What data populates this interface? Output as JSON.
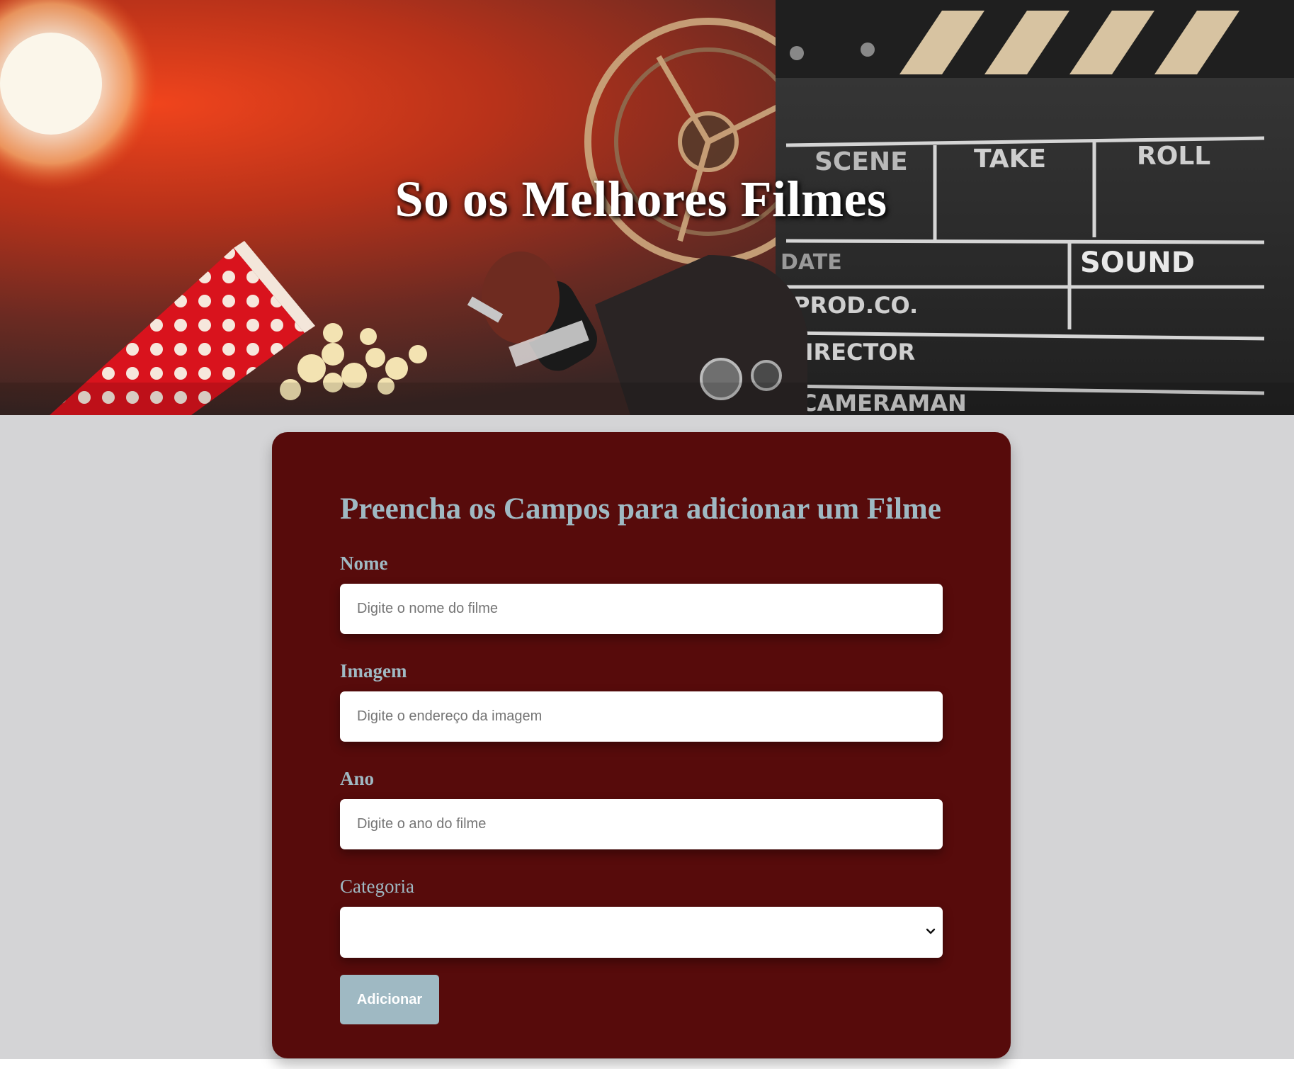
{
  "header": {
    "title": "So os Melhores Filmes"
  },
  "form": {
    "title": "Preencha os Campos para adicionar um Filme",
    "fields": {
      "nome": {
        "label": "Nome",
        "placeholder": "Digite o nome do filme",
        "value": ""
      },
      "imagem": {
        "label": "Imagem",
        "placeholder": "Digite o endereço da imagem",
        "value": ""
      },
      "ano": {
        "label": "Ano",
        "placeholder": "Digite o ano do filme",
        "value": ""
      },
      "categoria": {
        "label": "Categoria",
        "selected": ""
      }
    },
    "submit_label": "Adicionar"
  },
  "banner_art": {
    "clapper_labels": [
      "SCENE",
      "TAKE",
      "ROLL",
      "DATE",
      "SOUND",
      "PROD.CO.",
      "DIRECTOR",
      "CAMERAMAN"
    ]
  },
  "colors": {
    "page_background": "#d4d4d6",
    "card_background": "#570b0b",
    "accent": "#9fb9c3",
    "input_background": "#ffffff"
  },
  "icons": {
    "select_arrow": "chevron-down-icon"
  }
}
